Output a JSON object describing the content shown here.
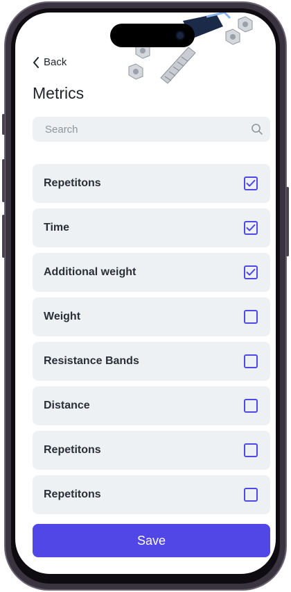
{
  "header": {
    "back_label": "Back",
    "title": "Metrics"
  },
  "search": {
    "placeholder": "Search",
    "value": ""
  },
  "metrics": [
    {
      "label": "Repetitons",
      "checked": true
    },
    {
      "label": "Time",
      "checked": true
    },
    {
      "label": "Additional weight",
      "checked": true
    },
    {
      "label": "Weight",
      "checked": false
    },
    {
      "label": "Resistance Bands",
      "checked": false
    },
    {
      "label": "Distance",
      "checked": false
    },
    {
      "label": "Repetitons",
      "checked": false
    },
    {
      "label": "Repetitons",
      "checked": false
    }
  ],
  "footer": {
    "save_label": "Save"
  },
  "colors": {
    "accent": "#5146e6",
    "row_background": "#eef1f3",
    "text": "#2a2f36",
    "placeholder": "#8e959c"
  },
  "icons": {
    "back": "chevron-left-icon",
    "search": "search-icon",
    "check": "check-icon",
    "decoration": "bolts-and-nuts-illustration"
  }
}
